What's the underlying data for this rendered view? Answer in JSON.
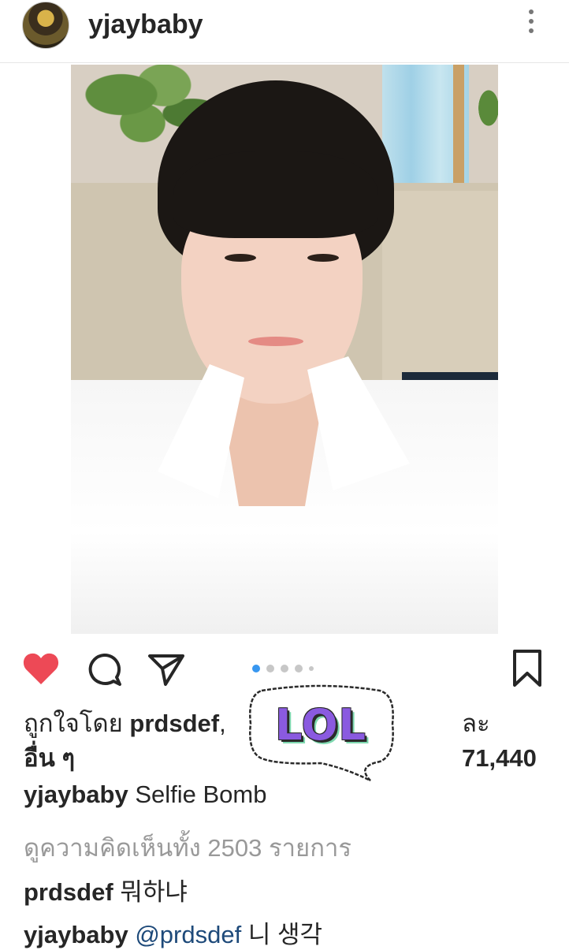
{
  "header": {
    "username": "yjaybaby"
  },
  "post": {
    "carousel": {
      "total": 5,
      "active": 1
    }
  },
  "likes": {
    "prefix": "ถูกใจโดย ",
    "first_user": "prdsdef",
    "suffix_partial": "ละ ",
    "count": "71,440",
    "others": "อื่น ๆ"
  },
  "caption": {
    "username": "yjaybaby",
    "text": "Selfie Bomb"
  },
  "view_comments": "ดูความคิดเห็นทั้ง 2503 รายการ",
  "comments": [
    {
      "username": "prdsdef",
      "text": "뭐하냐"
    },
    {
      "username": "yjaybaby",
      "mention": "@prdsdef",
      "text": "니 생각"
    }
  ],
  "sticker": {
    "text": "LOL"
  },
  "colors": {
    "heart": "#ed4956",
    "active_dot": "#3897f0",
    "muted_text": "#999999"
  }
}
